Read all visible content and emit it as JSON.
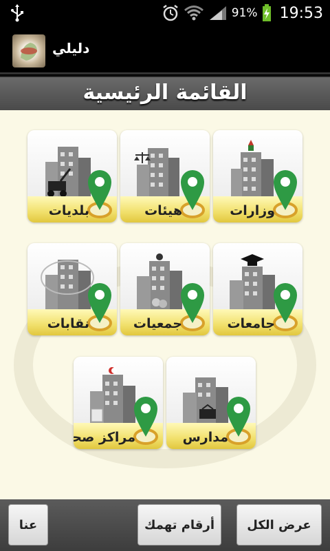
{
  "status_bar": {
    "battery_percent": "91%",
    "time": "19:53"
  },
  "app": {
    "title": "دليلي"
  },
  "header": {
    "title": "القائمة الرئيسية"
  },
  "tiles": [
    {
      "label": "وزارات",
      "icon": "ministry-building-icon"
    },
    {
      "label": "هيئات",
      "icon": "authority-building-icon"
    },
    {
      "label": "بلديات",
      "icon": "municipality-building-icon"
    },
    {
      "label": "جامعات",
      "icon": "university-building-icon"
    },
    {
      "label": "جمعيات",
      "icon": "association-building-icon"
    },
    {
      "label": "نقابات",
      "icon": "syndicate-building-icon"
    },
    {
      "label": "مدارس",
      "icon": "school-building-icon"
    },
    {
      "label": "مراكز صحية",
      "icon": "health-center-building-icon"
    }
  ],
  "bottom_bar": {
    "show_all": "عرض الكل",
    "important_numbers": "أرقام تهمك",
    "about_us": "عنا"
  },
  "colors": {
    "pin_green": "#2e9a44",
    "band_yellow": "#f1e06c",
    "content_bg": "#fbf9e6"
  }
}
